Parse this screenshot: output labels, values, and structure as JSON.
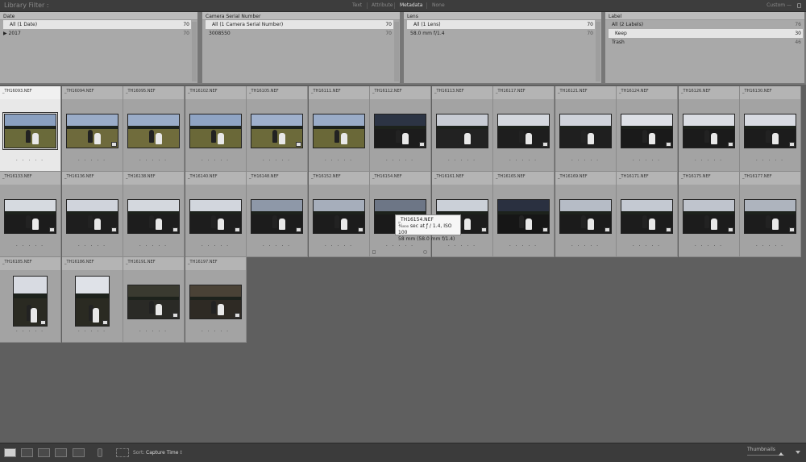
{
  "filter_bar": {
    "title": "Library Filter :",
    "tabs": [
      "Text",
      "Attribute",
      "Metadata",
      "None"
    ],
    "custom_label": "Custom —"
  },
  "columns": [
    {
      "header": "Date",
      "rows": [
        {
          "label": "All (1 Date)",
          "count": "70",
          "selected": true
        },
        {
          "label": "▶ 2017",
          "count": "70",
          "selected": false
        }
      ]
    },
    {
      "header": "Camera Serial Number",
      "rows": [
        {
          "label": "All (1 Camera Serial Number)",
          "count": "70",
          "selected": true
        },
        {
          "label": "3008550",
          "count": "70",
          "selected": false
        }
      ]
    },
    {
      "header": "Lens",
      "rows": [
        {
          "label": "All (1 Lens)",
          "count": "70",
          "selected": true
        },
        {
          "label": "58.0 mm f/1.4",
          "count": "70",
          "selected": false
        }
      ]
    },
    {
      "header": "Label",
      "rows": [
        {
          "label": "All (2 Labels)",
          "count": "76",
          "selected": false
        },
        {
          "label": "Keep",
          "count": "30",
          "selected": true
        },
        {
          "label": "Trash",
          "count": "46",
          "selected": false
        }
      ]
    }
  ],
  "photos": [
    "_TH16093.NEF",
    "_TH16094.NEF",
    "_TH16095.NEF",
    "_TH16102.NEF",
    "_TH16105.NEF",
    "_TH16111.NEF",
    "_TH16112.NEF",
    "_TH16113.NEF",
    "_TH16117.NEF",
    "_TH16121.NEF",
    "_TH16124.NEF",
    "_TH16126.NEF",
    "_TH16130.NEF",
    "_TH16133.NEF",
    "_TH16136.NEF",
    "_TH16138.NEF",
    "_TH16140.NEF",
    "_TH16148.NEF",
    "_TH16152.NEF",
    "_TH16154.NEF",
    "_TH16161.NEF",
    "_TH16165.NEF",
    "_TH16169.NEF",
    "_TH16171.NEF",
    "_TH16175.NEF",
    "_TH16177.NEF",
    "_TH16185.NEF",
    "_TH16186.NEF",
    "_TH16191.NEF",
    "_TH16197.NEF"
  ],
  "rating_dots": "· · · · ·",
  "tooltip": {
    "filename": "_TH16154.NEF",
    "exposure": "¹⁄₄₀₀₀ sec at ƒ / 1.4, ISO 100",
    "lens": "58 mm (58.0 mm f/1.4)"
  },
  "toolbar": {
    "sort_label": "Sort:",
    "sort_value": "Capture Time",
    "sort_caret": "↕",
    "thumbnails_label": "Thumbnails"
  },
  "colors": {
    "panel_bg": "#a9a9a9",
    "selected_cell": "#e8e8e8",
    "grid_bg": "#5f5f5f",
    "toolbar_bg": "#3b3b3b"
  }
}
